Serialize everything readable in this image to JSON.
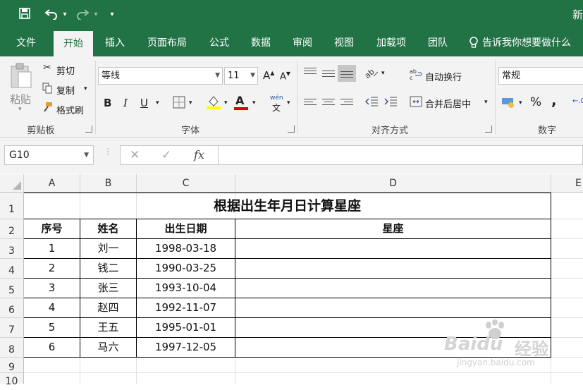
{
  "quick_access": {
    "undo_arrow": "▾",
    "redo_arrow": "▾",
    "customize": "▾"
  },
  "window_title_partial": "新",
  "tabs": [
    "文件",
    "开始",
    "插入",
    "页面布局",
    "公式",
    "数据",
    "审阅",
    "视图",
    "加载项",
    "团队"
  ],
  "tell_me": "告诉我你想要做什么",
  "ribbon": {
    "clipboard": {
      "paste": "粘贴",
      "cut": "剪切",
      "copy": "复制",
      "format_painter": "格式刷",
      "label": "剪贴板"
    },
    "font": {
      "name": "等线",
      "size": "11",
      "grow": "A",
      "shrink": "A",
      "bold": "B",
      "italic": "I",
      "underline": "U",
      "font_color": "A",
      "phonetic": "wén",
      "label": "字体"
    },
    "alignment": {
      "wrap_text": "自动换行",
      "merge_center": "合并后居中",
      "label": "对齐方式"
    },
    "number": {
      "format": "常规",
      "percent": "%",
      "comma": ",",
      "label": "数字"
    }
  },
  "formula_bar": {
    "name_box": "G10",
    "cancel": "✕",
    "enter": "✓",
    "fx": "fx",
    "value": ""
  },
  "columns": [
    "A",
    "B",
    "C",
    "D",
    "E"
  ],
  "rows": [
    "1",
    "2",
    "3",
    "4",
    "5",
    "6",
    "7",
    "8",
    "9",
    "10"
  ],
  "sheet": {
    "title": "根据出生年月日计算星座",
    "headers": [
      "序号",
      "姓名",
      "出生日期",
      "星座"
    ],
    "data": [
      [
        "1",
        "刘一",
        "1998-03-18",
        ""
      ],
      [
        "2",
        "钱二",
        "1990-03-25",
        ""
      ],
      [
        "3",
        "张三",
        "1993-10-04",
        ""
      ],
      [
        "4",
        "赵四",
        "1992-11-07",
        ""
      ],
      [
        "5",
        "王五",
        "1995-01-01",
        ""
      ],
      [
        "6",
        "马六",
        "1997-12-05",
        ""
      ]
    ]
  },
  "watermark": {
    "brand": "Baidu",
    "brand_cn": "经验",
    "url": "jingyan.baidu.com"
  },
  "colors": {
    "excel_green": "#217346",
    "ribbon_bg": "#f3f3f3",
    "gridline": "#e1e1e1"
  }
}
